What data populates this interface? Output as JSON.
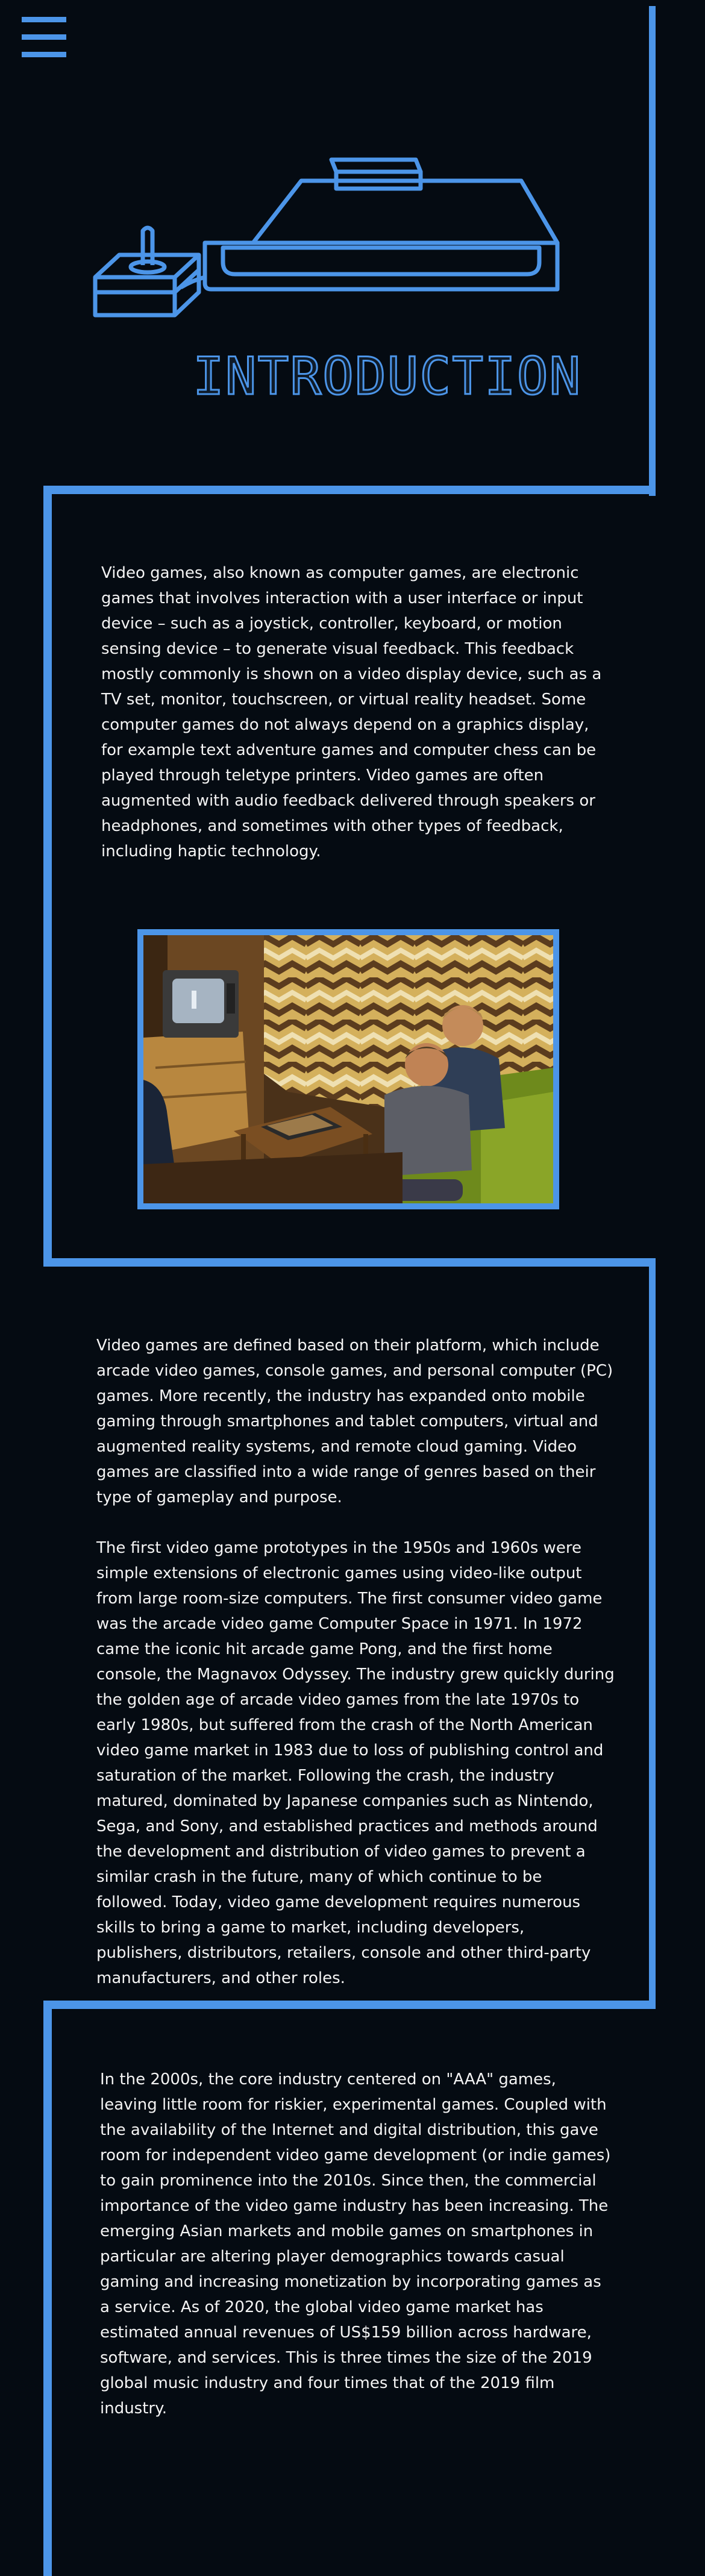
{
  "nav": {
    "menu_icon": "hamburger-menu-icon"
  },
  "hero": {
    "illustration": "retro-console-joystick-icon",
    "title": "INTRODUCTION"
  },
  "sections": [
    {
      "paragraphs": [
        "Video games, also known as computer games, are electronic games that involves interaction with a user interface or input device – such as a joystick, controller, keyboard, or motion sensing device – to generate visual feedback. This feedback mostly commonly is shown on a video display device, such as a TV set, monitor, touchscreen, or virtual reality headset. Some computer games do not always depend on a graphics display, for example text adventure games and computer chess can be played through teletype printers. Video games are often augmented with audio feedback delivered through speakers or headphones, and sometimes with other types of feedback, including haptic technology."
      ]
    },
    {
      "paragraphs": [
        "Video games are defined based on their platform, which include arcade video games, console games, and personal computer (PC) games. More recently, the industry has expanded onto mobile gaming through smartphones and tablet computers, virtual and augmented reality systems, and remote cloud gaming. Video games are classified into a wide range of genres based on their type of gameplay and purpose.",
        "The first video game prototypes in the 1950s and 1960s were simple extensions of electronic games using video-like output from large room-size computers. The first consumer video game was the arcade video game Computer Space in 1971. In 1972 came the iconic hit arcade game Pong, and the first home console, the Magnavox Odyssey. The industry grew quickly during the golden age of arcade video games from the late 1970s to early 1980s, but suffered from the crash of the North American video game market in 1983 due to loss of publishing control and saturation of the market. Following the crash, the industry matured, dominated by Japanese companies such as Nintendo, Sega, and Sony, and established practices and methods around the development and distribution of video games to prevent a similar crash in the future, many of which continue to be followed. Today, video game development requires numerous skills to bring a game to market, including developers, publishers, distributors, retailers, console and other third-party manufacturers, and other roles."
      ]
    },
    {
      "paragraphs": [
        "In the 2000s, the core industry centered on \"AAA\" games, leaving little room for riskier, experimental games. Coupled with the availability of the Internet and digital distribution, this gave room for independent video game development (or indie games) to gain prominence into the 2010s. Since then, the commercial importance of the video game industry has been increasing. The emerging Asian markets and mobile games on smartphones in particular are altering player demographics towards casual gaming and increasing monetization by incorporating games as a service. As of 2020, the global video game market has estimated annual revenues of US$159 billion across hardware, software, and services. This is three times the size of the 2019 global music industry and four times that of the 2019 film industry."
      ]
    }
  ],
  "photo": {
    "subject": "children-playing-retro-console-photo"
  },
  "colors": {
    "accent": "#4c95e8",
    "background": "#050b12",
    "text": "#f4f4f4"
  }
}
